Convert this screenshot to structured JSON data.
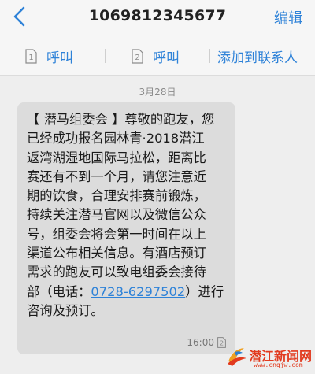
{
  "header": {
    "title": "1069812345677",
    "edit_label": "编辑",
    "back_icon": "chevron-left-icon"
  },
  "actions": [
    {
      "label": "呼叫",
      "sim": "1",
      "icon": "sim1-icon"
    },
    {
      "label": "呼叫",
      "sim": "2",
      "icon": "sim2-icon"
    },
    {
      "label": "添加到联系人"
    }
  ],
  "thread": {
    "date": "3月28日",
    "message": {
      "lines": [
        "【 潜马组委会 】尊敬的跑友，您",
        "已经成功报名园林青·2018潜江",
        "返湾湖湿地国际马拉松，距离比",
        "赛还有不到一个月，请您注意近",
        "期的饮食，合理安排赛前锻炼，",
        "持续关注潜马官网以及微信公众",
        "号，组委会将会第一时间在以上",
        "渠道公布相关信息。有酒店预订",
        "需求的跑友可以致电组委会接待"
      ],
      "last_line_prefix": "部（电话：",
      "phone": "0728-6297502",
      "last_line_suffix": "）进行",
      "final_line": "咨询及预订。",
      "time": "16:00",
      "sim_badge": "2"
    }
  },
  "watermark": {
    "name": "潜江新闻网",
    "url": "www.cnqjw.com"
  },
  "colors": {
    "accent": "#2e82d8",
    "bubble": "#dcdcdc",
    "background": "#eeeeee",
    "watermark": "#e23a1e"
  }
}
